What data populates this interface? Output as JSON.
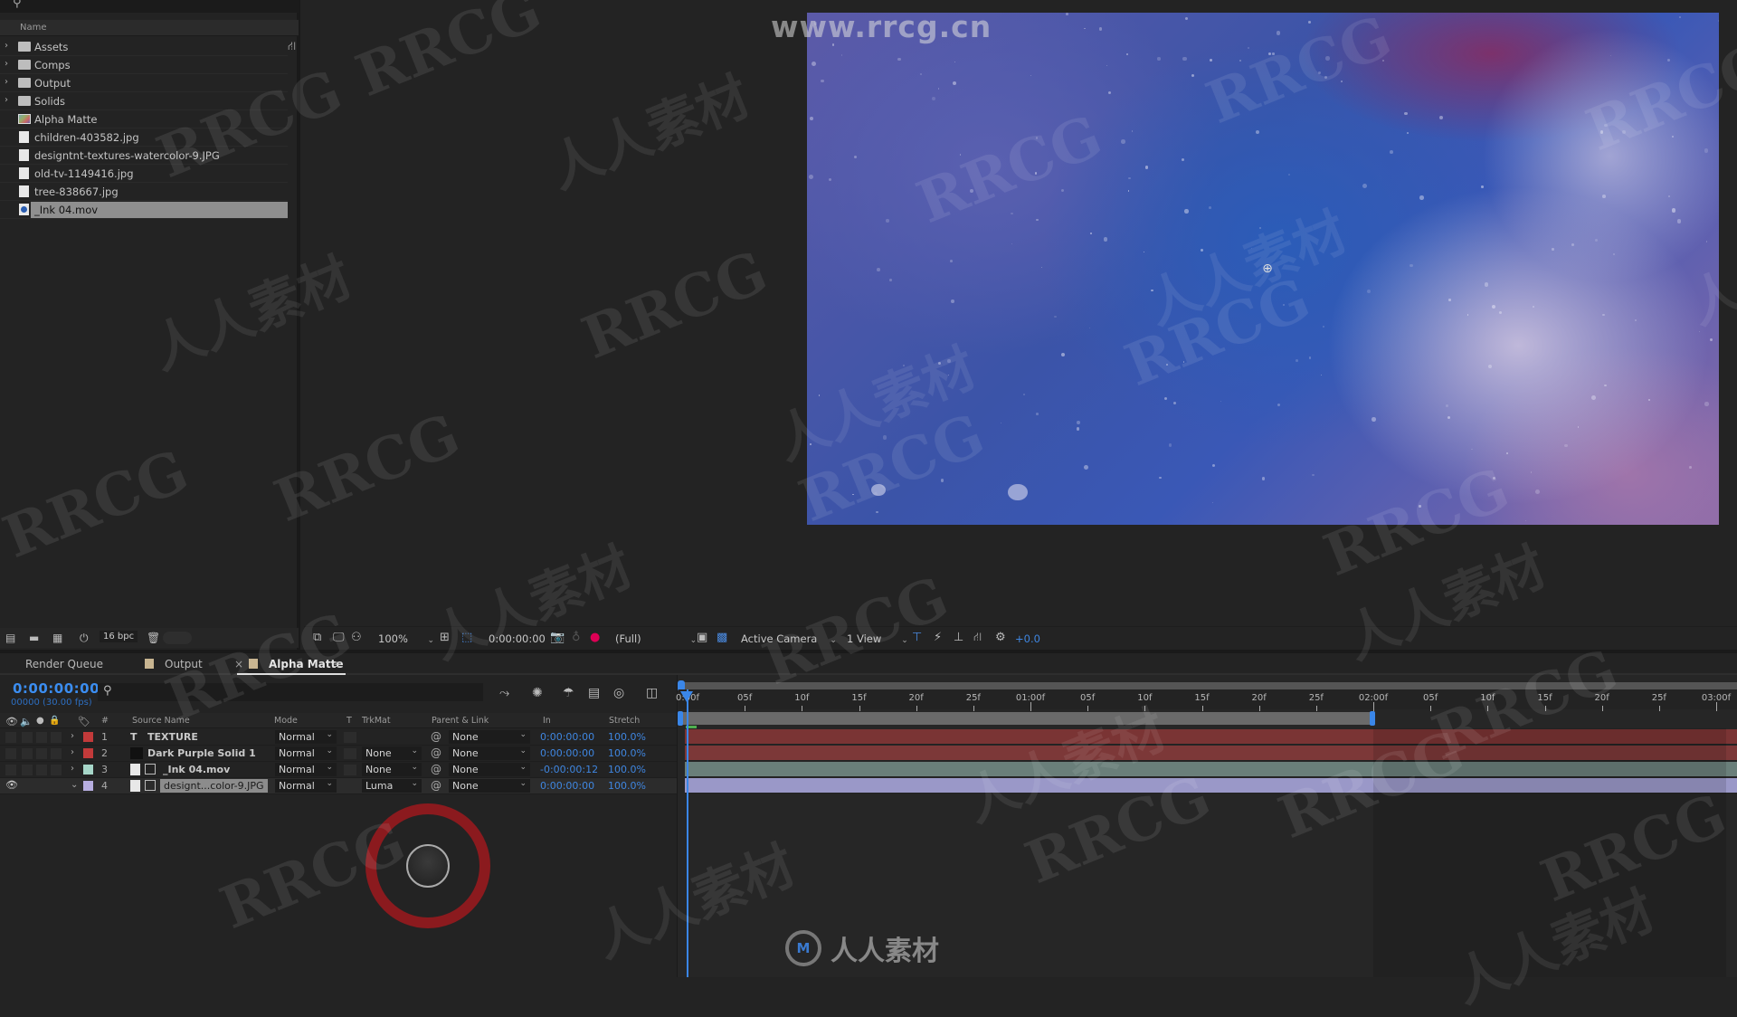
{
  "project": {
    "search_icon": "search-icon",
    "column_name": "Name",
    "items": [
      {
        "name": "Assets",
        "type": "folder"
      },
      {
        "name": "Comps",
        "type": "folder"
      },
      {
        "name": "Output",
        "type": "folder"
      },
      {
        "name": "Solids",
        "type": "folder"
      },
      {
        "name": "Alpha Matte",
        "type": "composition"
      },
      {
        "name": "children-403582.jpg",
        "type": "image"
      },
      {
        "name": "designtnt-textures-watercolor-9.JPG",
        "type": "image"
      },
      {
        "name": "old-tv-1149416.jpg",
        "type": "image"
      },
      {
        "name": "tree-838667.jpg",
        "type": "image"
      },
      {
        "name": "_Ink 04.mov",
        "type": "movie",
        "selected": true
      }
    ],
    "footer": {
      "bpc": "16 bpc"
    }
  },
  "viewer": {
    "zoom": "100%",
    "timecode": "0:00:00:00",
    "resolution": "(Full)",
    "camera": "Active Camera",
    "views": "1 View",
    "exposure": "+0.0"
  },
  "timeline": {
    "tabs": [
      {
        "label": "Render Queue"
      },
      {
        "label": "Output"
      },
      {
        "label": "Alpha Matte",
        "active": true
      }
    ],
    "close_glyph": "×",
    "menu_glyph": "≡",
    "current_time": "0:00:00:00",
    "current_frame": "00000 (30.00 fps)",
    "columns": {
      "source_name": "Source Name",
      "hash": "#",
      "mode": "Mode",
      "t": "T",
      "trkmat": "TrkMat",
      "parent": "Parent & Link",
      "in": "In",
      "stretch": "Stretch"
    },
    "layers": [
      {
        "num": "1",
        "name": "TEXTURE",
        "type": "text",
        "label_color": "#c23a3a",
        "mode": "Normal",
        "trkmat": "",
        "parent": "None",
        "in": "0:00:00:00",
        "stretch": "100.0%",
        "bar_color": "#7a3434"
      },
      {
        "num": "2",
        "name": "Dark Purple Solid 1",
        "type": "solid",
        "label_color": "#c23a3a",
        "mode": "Normal",
        "trkmat": "None",
        "parent": "None",
        "in": "0:00:00:00",
        "stretch": "100.0%",
        "bar_color": "#7c3838"
      },
      {
        "num": "3",
        "name": "_Ink 04.mov",
        "type": "movie",
        "label_color": "#a6d6c8",
        "mode": "Normal",
        "trkmat": "None",
        "parent": "None",
        "in": "-0:00:00:12",
        "stretch": "100.0%",
        "bar_color": "#6a7f7a"
      },
      {
        "num": "4",
        "name": "designt...color-9.JPG",
        "type": "image",
        "label_color": "#b7aee0",
        "mode": "Normal",
        "trkmat": "Luma",
        "parent": "None",
        "in": "0:00:00:00",
        "stretch": "100.0%",
        "bar_color": "#9a98c8",
        "visible": true,
        "expanded": true
      }
    ],
    "ruler_ticks": [
      "0:00f",
      "05f",
      "10f",
      "15f",
      "20f",
      "25f",
      "01:00f",
      "05f",
      "10f",
      "15f",
      "20f",
      "25f",
      "02:00f",
      "05f",
      "10f",
      "15f",
      "20f",
      "25f",
      "03:00f"
    ],
    "work_area_end_seconds": 2.0
  },
  "watermarks": {
    "url": "www.rrcg.cn",
    "latin": "RRCG",
    "chinese": "人人素材",
    "logo_text": "人人素材"
  }
}
